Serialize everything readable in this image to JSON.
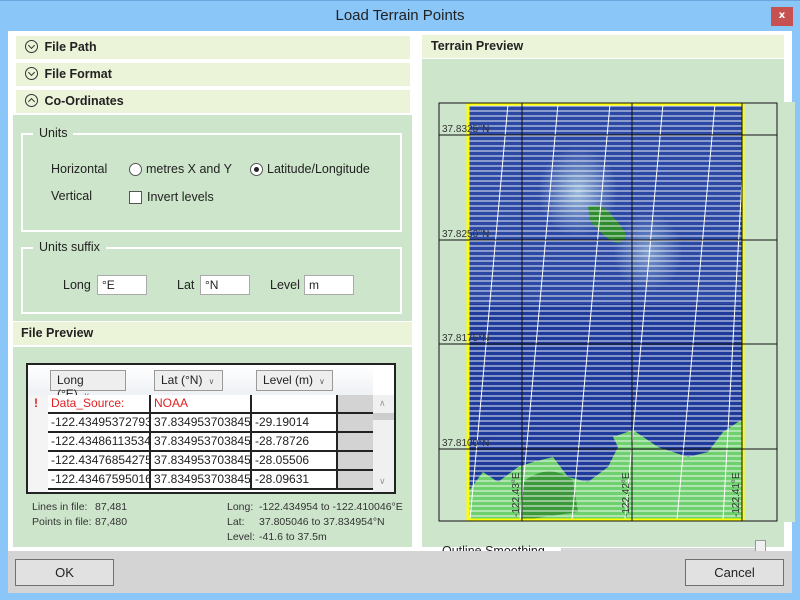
{
  "window": {
    "title": "Load Terrain Points",
    "close_label": "x"
  },
  "sections": {
    "file_path": "File Path",
    "file_format": "File Format",
    "coordinates": "Co-Ordinates",
    "file_preview": "File Preview",
    "terrain_preview": "Terrain Preview"
  },
  "units": {
    "group_title": "Units",
    "horizontal_label": "Horizontal",
    "horizontal_options": [
      {
        "label": "metres X and Y",
        "selected": false
      },
      {
        "label": "Latitude/Longitude",
        "selected": true
      }
    ],
    "vertical_label": "Vertical",
    "invert_levels": {
      "label": "Invert levels",
      "checked": false
    }
  },
  "units_suffix": {
    "group_title": "Units suffix",
    "long_label": "Long",
    "long_value": "°E",
    "lat_label": "Lat",
    "lat_value": "°N",
    "level_label": "Level",
    "level_value": "m"
  },
  "file_preview": {
    "columns": [
      "Long (°E)",
      "Lat (°N)",
      "Level (m)"
    ],
    "rows": [
      {
        "flag": "!",
        "cells": [
          "Data_Source:",
          "NOAA",
          ""
        ],
        "error": true
      },
      {
        "flag": "",
        "cells": [
          "-122.43495372793",
          "37.834953703845",
          "-29.19014"
        ],
        "error": false
      },
      {
        "flag": "",
        "cells": [
          "-122.43486113534",
          "37.834953703845",
          "-28.78726"
        ],
        "error": false
      },
      {
        "flag": "",
        "cells": [
          "-122.43476854275",
          "37.834953703845",
          "-28.05506"
        ],
        "error": false
      },
      {
        "flag": "",
        "cells": [
          "-122.43467595016",
          "37.834953703845",
          "-28.09631"
        ],
        "error": false
      }
    ],
    "stats": {
      "lines_label": "Lines in file:",
      "lines_value": "87,481",
      "points_label": "Points in file:",
      "points_value": "87,480",
      "long_label": "Long:",
      "long_value": "-122.434954 to -122.410046°E",
      "lat_label": "Lat:",
      "lat_value": "37.805046 to 37.834954°N",
      "level_label": "Level:",
      "level_value": "-41.6 to 37.5m"
    }
  },
  "terrain_preview": {
    "lat_labels": [
      "37.8325°N",
      "37.8250°N",
      "37.8175°N",
      "37.8100°N"
    ],
    "long_labels": [
      "-122.43°E",
      "-122.42°E",
      "-122.41°E"
    ],
    "outline_smoothing_label": "Outline Smoothing",
    "outline_smoothing_value": 1.0,
    "colors": {
      "water": "#1a2f8c",
      "land": "#6fd06f",
      "outline": "#ffff00"
    }
  },
  "buttons": {
    "ok": "OK",
    "cancel": "Cancel"
  }
}
